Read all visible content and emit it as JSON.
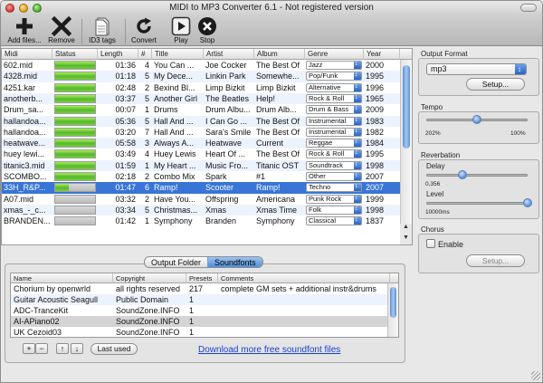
{
  "window": {
    "title": "MIDI to MP3 Converter 6.1 - Not registered version"
  },
  "toolbar": {
    "add_files": "Add files...",
    "remove": "Remove",
    "id3_tags": "ID3 tags",
    "convert": "Convert",
    "play": "Play",
    "stop": "Stop"
  },
  "playlist": {
    "columns": [
      "Midi",
      "Status",
      "Length",
      "#",
      "Title",
      "Artist",
      "Album",
      "Genre",
      "Year"
    ],
    "rows": [
      {
        "midi": "602.mid",
        "progress": 1.0,
        "length": "01:36",
        "num": "4",
        "title": "You Can ...",
        "artist": "Joe Cocker",
        "album": "The Best Of",
        "genre": "Jazz",
        "year": "2000"
      },
      {
        "midi": "4328.mid",
        "progress": 1.0,
        "length": "01:18",
        "num": "5",
        "title": "My Dece...",
        "artist": "Linkin Park",
        "album": "Somewhe...",
        "genre": "Pop/Funk",
        "year": "1995"
      },
      {
        "midi": "4251.kar",
        "progress": 1.0,
        "length": "02:48",
        "num": "2",
        "title": "Bexind Bl...",
        "artist": "Limp Bizkit",
        "album": "Limp Bizkit",
        "genre": "Alternative",
        "year": "1996"
      },
      {
        "midi": "anotherb...",
        "progress": 1.0,
        "length": "03:37",
        "num": "5",
        "title": "Another Girl",
        "artist": "The Beatles",
        "album": "Help!",
        "genre": "Rock & Roll",
        "year": "1965"
      },
      {
        "midi": "Drum_sa...",
        "progress": 1.0,
        "length": "00:07",
        "num": "1",
        "title": "Drums",
        "artist": "Drum Albu...",
        "album": "Drum Alb...",
        "genre": "Drum & Bass",
        "year": "2009"
      },
      {
        "midi": "hallandoa...",
        "progress": 1.0,
        "length": "05:36",
        "num": "5",
        "title": "Hall And ...",
        "artist": "I Can Go ...",
        "album": "The Best Of",
        "genre": "Instrumental",
        "year": "1983"
      },
      {
        "midi": "hallandoa...",
        "progress": 1.0,
        "length": "03:20",
        "num": "7",
        "title": "Hall And ...",
        "artist": "Sara's Smile",
        "album": "The Best Of",
        "genre": "Instrumental",
        "year": "1982"
      },
      {
        "midi": "heatwave...",
        "progress": 1.0,
        "length": "05:58",
        "num": "3",
        "title": "Always A...",
        "artist": "Heatwave",
        "album": "Current",
        "genre": "Reggae",
        "year": "1984"
      },
      {
        "midi": "huey lewi...",
        "progress": 1.0,
        "length": "03:49",
        "num": "4",
        "title": "Huey Lewis",
        "artist": "Heart Of ...",
        "album": "The Best Of",
        "genre": "Rock & Roll",
        "year": "1995"
      },
      {
        "midi": "titanic3.mid",
        "progress": 1.0,
        "length": "01:59",
        "num": "1",
        "title": "My Heart ...",
        "artist": "Music Fro...",
        "album": "Titanic OST",
        "genre": "Soundtrack",
        "year": "1998"
      },
      {
        "midi": "SCOMBO...",
        "progress": 1.0,
        "length": "02:18",
        "num": "2",
        "title": "Combo Mix",
        "artist": "Spark",
        "album": "#1",
        "genre": "Other",
        "year": "2007"
      },
      {
        "midi": "33H_R&P...",
        "progress": 0.35,
        "length": "01:47",
        "num": "6",
        "title": "Ramp!",
        "artist": "Scooter",
        "album": "Ramp!",
        "genre": "Techno",
        "year": "2007"
      },
      {
        "midi": "A07.mid",
        "progress": 0.0,
        "length": "03:32",
        "num": "2",
        "title": "Have You...",
        "artist": "Offspring",
        "album": "Americana",
        "genre": "Punk Rock",
        "year": "1999"
      },
      {
        "midi": "xmas_-_c...",
        "progress": 0.0,
        "length": "03:34",
        "num": "5",
        "title": "Christmas...",
        "artist": "Xmas",
        "album": "Xmas Time",
        "genre": "Folk",
        "year": "1998"
      },
      {
        "midi": "BRANDEN...",
        "progress": 0.0,
        "length": "01:42",
        "num": "1",
        "title": "Symphony",
        "artist": "Branden",
        "album": "Symphony",
        "genre": "Classical",
        "year": "1837"
      }
    ]
  },
  "tabs": {
    "output_folder": "Output Folder",
    "soundfonts": "Soundfonts"
  },
  "soundfonts": {
    "columns": [
      "Name",
      "Copyright",
      "Presets",
      "Comments"
    ],
    "rows": [
      {
        "name": "Chorium by openwrld",
        "copyright": "all rights reserved",
        "presets": "217",
        "comments": "complete GM sets + additional instr&drums"
      },
      {
        "name": "Guitar Acoustic Seagull",
        "copyright": "Public Domain",
        "presets": "1",
        "comments": ""
      },
      {
        "name": "ADC-TranceKit",
        "copyright": "SoundZone.INFO",
        "presets": "1",
        "comments": ""
      },
      {
        "name": "AI-APiano02",
        "copyright": "SoundZone.INFO",
        "presets": "1",
        "comments": ""
      },
      {
        "name": "UK Cezoid03",
        "copyright": "SoundZone.INFO",
        "presets": "1",
        "comments": ""
      }
    ],
    "add": "+",
    "remove": "−",
    "up": "↑",
    "down": "↓",
    "last_used": "Last used",
    "download_link": "Download more free soundfont files"
  },
  "output_format": {
    "label": "Output Format",
    "value": "mp3",
    "setup": "Setup..."
  },
  "tempo": {
    "label": "Tempo",
    "min": "202%",
    "max": "100%",
    "level": 0.5
  },
  "reverbation": {
    "label": "Reverbation",
    "delay_label": "Delay",
    "delay_value": "0,356",
    "delay_level": 0.36,
    "level_label": "Level",
    "level_value": "10000ms",
    "level_level": 1.0
  },
  "chorus": {
    "label": "Chorus",
    "enable": "Enable",
    "setup": "Setup..."
  }
}
